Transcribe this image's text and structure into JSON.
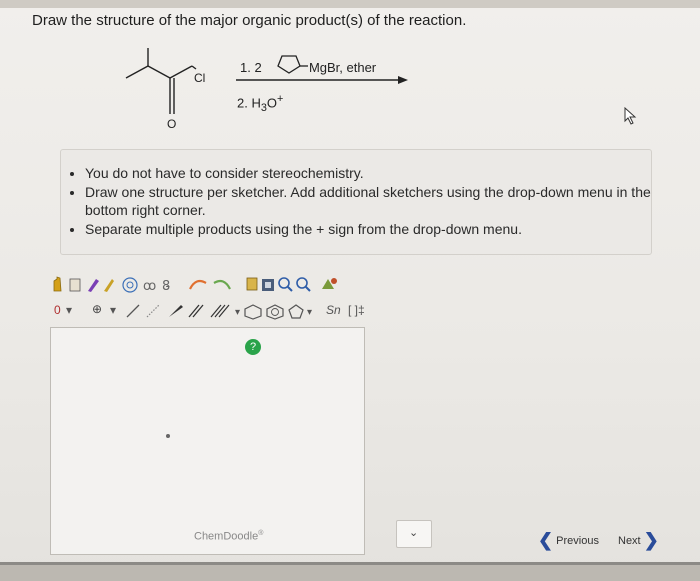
{
  "question": "Draw the structure of the major organic product(s) of the reaction.",
  "reaction": {
    "reagent1_prefix": "1. 2",
    "reagent1_suffix": "MgBr, ether",
    "reagent2_prefix": "2. H",
    "reagent2_sub": "3",
    "reagent2_mid": "O",
    "reagent2_sup": "+",
    "cl_label": "Cl",
    "o_label": "O"
  },
  "notes": [
    "You do not have to consider stereochemistry.",
    "Draw one structure per sketcher. Add additional sketchers using the drop-down menu in the bottom right corner.",
    "Separate multiple products using the + sign from the drop-down menu."
  ],
  "toolbar2": {
    "charge_label": "0",
    "plus_label": "⊕",
    "bracket_label": "[ ]‡",
    "chain_label": "Sn"
  },
  "sketcher": {
    "help_label": "?",
    "brand": "ChemDoodle",
    "brand_mark": "®"
  },
  "navigation": {
    "previous": "Previous",
    "next": "Next"
  },
  "colors": {
    "help": "#2aa34a",
    "nav_chevron": "#2a4c9a"
  }
}
